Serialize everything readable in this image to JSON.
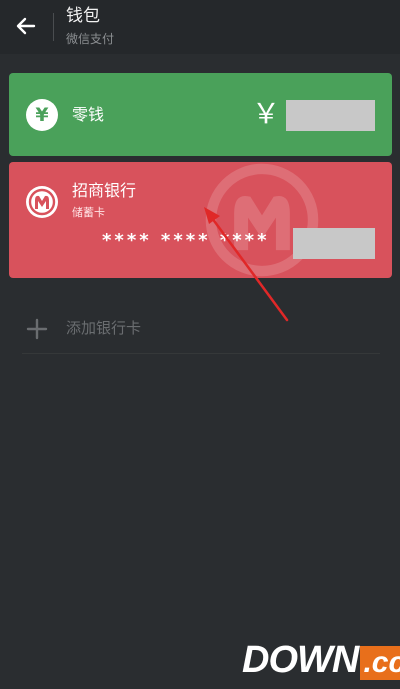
{
  "header": {
    "title": "钱包",
    "subtitle": "微信支付",
    "back_icon": "arrow-left-icon"
  },
  "change_card": {
    "label": "零钱",
    "icon": "yen-icon",
    "icon_glyph": "¥",
    "amount_symbol": "￥",
    "color": "#4aa15a"
  },
  "bank_card": {
    "name": "招商银行",
    "type": "储蓄卡",
    "number_masked": "**** **** ****",
    "icon": "cmb-logo-icon",
    "color": "#d8525c"
  },
  "add_card": {
    "label": "添加银行卡",
    "icon": "plus-icon"
  },
  "annotation": {
    "arrow_color": "#e02828"
  },
  "watermark": {
    "main": "DOWN",
    "tld": ".cc"
  }
}
